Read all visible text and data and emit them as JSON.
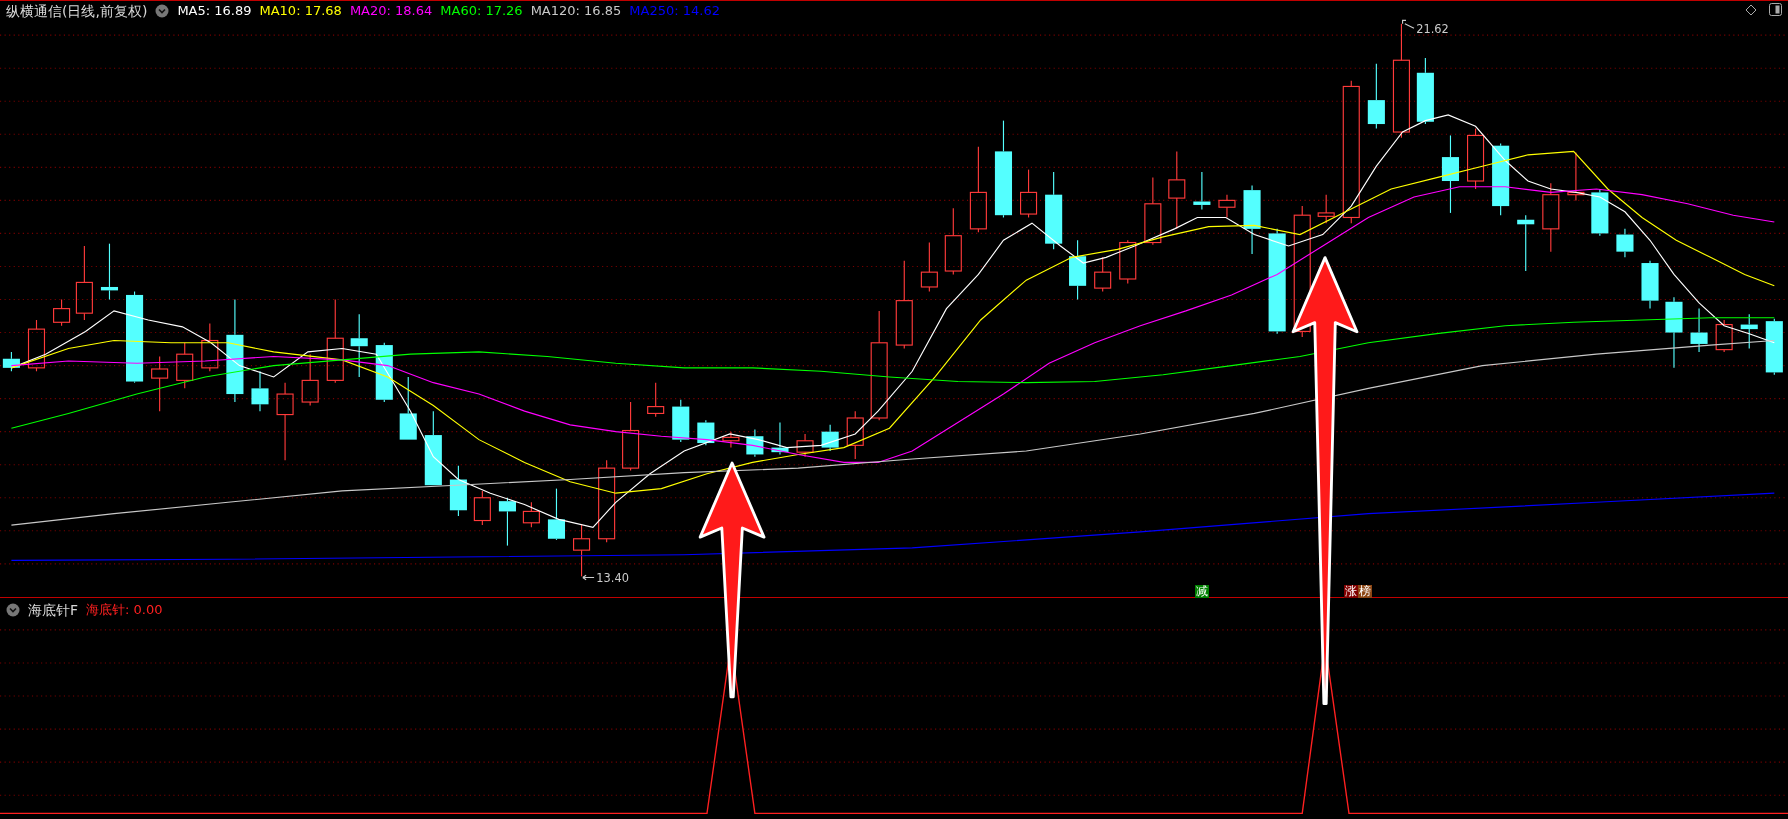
{
  "chart_title": "纵横通信(日线,前复权)",
  "moving_averages": [
    {
      "label": "MA5: 16.89",
      "color": "#ffffff"
    },
    {
      "label": "MA10: 17.68",
      "color": "#ffff00"
    },
    {
      "label": "MA20: 18.64",
      "color": "#ff00ff"
    },
    {
      "label": "MA60: 17.26",
      "color": "#00ff00"
    },
    {
      "label": "MA120: 16.85",
      "color": "#c8c8c8"
    },
    {
      "label": "MA250: 14.62",
      "color": "#0000ff"
    }
  ],
  "high_label": "21.62",
  "low_label": "13.40",
  "signals": [
    {
      "text": "减",
      "color": "#008000"
    },
    {
      "text": "涨",
      "color": "#800000"
    },
    {
      "text": "榜",
      "color": "#8b4513"
    }
  ],
  "indicator": {
    "name": "海底针F",
    "value_label": "海底针: 0.00"
  }
}
